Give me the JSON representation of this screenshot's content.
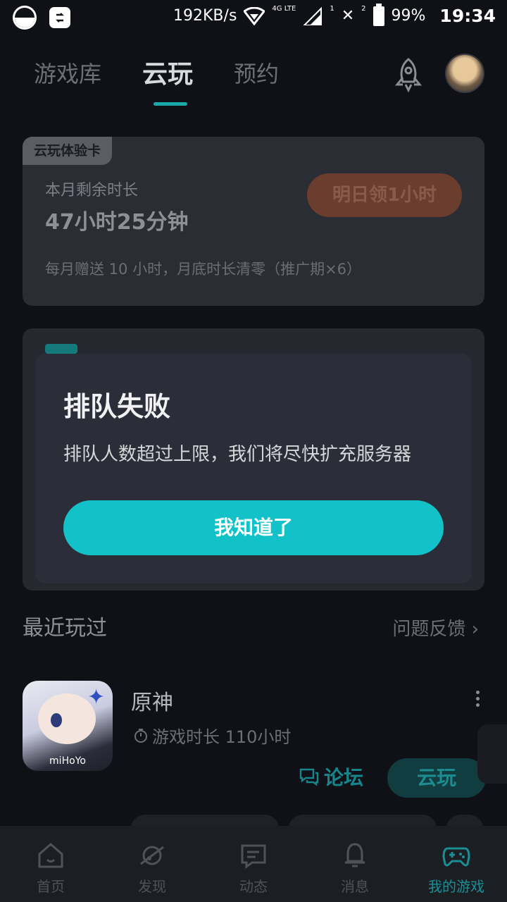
{
  "status_bar": {
    "speed": "192KB/s",
    "network": "4G LTE",
    "sim_one": "1",
    "sim_two": "2",
    "battery": "99%",
    "time": "19:34"
  },
  "header": {
    "tabs": [
      {
        "label": "游戏库",
        "active": false
      },
      {
        "label": "云玩",
        "active": true
      },
      {
        "label": "预约",
        "active": false
      }
    ]
  },
  "experience_card": {
    "badge": "云玩体验卡",
    "remaining_label": "本月剩余时长",
    "remaining_value": "47小时25分钟",
    "claim_button": "明日领1小时",
    "note": "每月赠送 10 小时，月底时长清零（推广期×6）"
  },
  "dialog": {
    "title": "排队失败",
    "message": "排队人数超过上限，我们将尽快扩充服务器",
    "confirm_button": "我知道了"
  },
  "recent": {
    "title": "最近玩过",
    "feedback_link": "问题反馈",
    "games": [
      {
        "name": "原神",
        "play_time": "游戏时长 110小时",
        "icon_brand": "miHoYo",
        "forum_label": "论坛",
        "cloud_label": "云玩"
      }
    ]
  },
  "bottom_nav": {
    "items": [
      {
        "label": "首页",
        "icon": "home-icon",
        "active": false
      },
      {
        "label": "发现",
        "icon": "planet-icon",
        "active": false
      },
      {
        "label": "动态",
        "icon": "message-icon",
        "active": false
      },
      {
        "label": "消息",
        "icon": "bell-icon",
        "active": false
      },
      {
        "label": "我的游戏",
        "icon": "gamepad-icon",
        "active": true
      }
    ]
  },
  "colors": {
    "accent": "#13c2c9",
    "background": "#0f1116",
    "dialog_bg": "#2b2e38"
  }
}
